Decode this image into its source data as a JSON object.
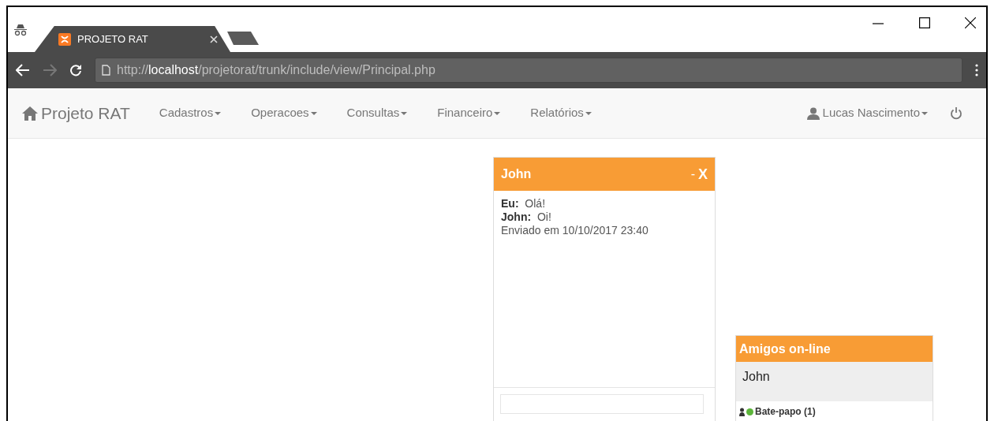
{
  "browser": {
    "tab": {
      "title": "PROJETO RAT"
    },
    "url": {
      "scheme": "http://",
      "host": "localhost",
      "path": "/projetorat/trunk/include/view/Principal.php"
    }
  },
  "navbar": {
    "brand": "Projeto RAT",
    "menus": [
      {
        "label": "Cadastros"
      },
      {
        "label": "Operacoes"
      },
      {
        "label": "Consultas"
      },
      {
        "label": "Financeiro"
      },
      {
        "label": "Relatórios"
      }
    ],
    "user": "Lucas Nascimento"
  },
  "chat": {
    "title": "John",
    "minimize": "-",
    "close": "X",
    "messages": [
      {
        "sender": "Eu:",
        "text": "Olá!"
      },
      {
        "sender": "John:",
        "text": "Oi!"
      }
    ],
    "sent_at": "Enviado em 10/10/2017 23:40"
  },
  "friends": {
    "title": "Amigos on-line",
    "items": [
      {
        "name": "John"
      }
    ],
    "footer": "Bate-papo (1)"
  }
}
